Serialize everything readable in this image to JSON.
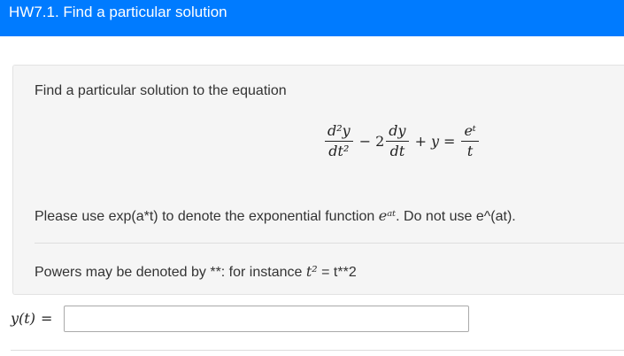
{
  "header": {
    "title": "HW7.1. Find a particular solution"
  },
  "question": {
    "prompt": "Find a particular solution to the equation",
    "equation": {
      "term1_num": "d²y",
      "term1_den": "dt²",
      "op1": "−",
      "coef2": "2",
      "term2_num": "dy",
      "term2_den": "dt",
      "op2": "+",
      "term3": "y",
      "eq": "=",
      "rhs_num": "eᵗ",
      "rhs_den": "t"
    },
    "note1_prefix": "Please use exp(a*t) to denote the exponential function ",
    "note1_math": "eᵃᵗ",
    "note1_suffix": ". Do not use e^(at).",
    "note2_prefix": "Powers may be denoted by **: for instance ",
    "note2_math": "t²",
    "note2_suffix": " = t**2"
  },
  "answer": {
    "label": "y(t)",
    "equals": "=",
    "value": "",
    "placeholder": ""
  },
  "colors": {
    "header_bg": "#007bff",
    "card_bg": "#f5f5f5"
  }
}
